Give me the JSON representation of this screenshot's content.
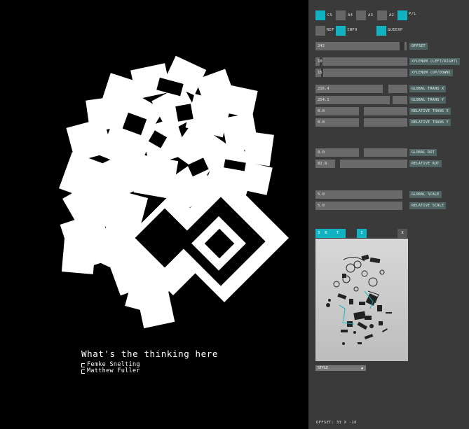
{
  "caption": {
    "title": "What's the thinking here",
    "authors": [
      "Femke Snelting",
      "Matthew Fuller"
    ]
  },
  "toggles_row1": [
    {
      "label": "CS",
      "on": true
    },
    {
      "label": "A4",
      "on": false
    },
    {
      "label": "A3",
      "on": false
    },
    {
      "label": "A2",
      "on": false
    },
    {
      "label": "P/L",
      "on": true
    }
  ],
  "toggles_row2": [
    {
      "label": "REF",
      "on": false
    },
    {
      "label": "INFO",
      "on": true
    },
    {
      "label": "GUIEXP",
      "on": true
    }
  ],
  "controls": {
    "offset": {
      "value": "242",
      "label": "OFFSET"
    },
    "xylenum_lr": {
      "value": "10",
      "label": "XYLENUM (LEFT/RIGHT)"
    },
    "xylenum_ud": {
      "value": "15",
      "label": "XYLENUM (UP/DOWN)"
    },
    "global_trans_x": {
      "value": "216.4",
      "label": "GLOBAL TRANS X"
    },
    "global_trans_y": {
      "value": "254.1",
      "label": "GLOBAL TRANS Y"
    },
    "relative_trans_x": {
      "value": "0.0",
      "label": "RELATIVE TRANS X"
    },
    "relative_trans_y": {
      "value": "0.0",
      "label": "RELATIVE TRANS Y"
    },
    "global_rot": {
      "value": "0.0",
      "label": "GLOBAL ROT"
    },
    "relative_rot": {
      "value": "82.8",
      "label": "RELATIVE ROT"
    },
    "global_scale": {
      "value": "5.0",
      "label": "GLOBAL SCALE"
    },
    "relative_scale": {
      "value": "5.0",
      "label": "RELATIVE SCALE"
    }
  },
  "image_tabs": [
    "S",
    "R",
    "T",
    "I"
  ],
  "close_label": "X",
  "style_label": "STYLE",
  "style_arrow": "▲",
  "offset_readout": "OFFSET: 33 X -10",
  "colors": {
    "accent": "#11b3c2",
    "panel": "#3a3a3a",
    "tag": "#4e6563"
  }
}
